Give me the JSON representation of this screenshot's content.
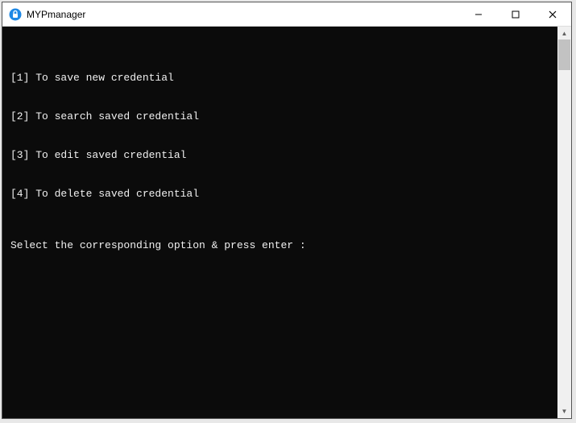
{
  "window": {
    "title": "MYPmanager"
  },
  "terminal": {
    "lines": [
      "[1] To save new credential",
      "[2] To search saved credential",
      "[3] To edit saved credential",
      "[4] To delete saved credential"
    ],
    "prompt": "Select the corresponding option & press enter :"
  }
}
